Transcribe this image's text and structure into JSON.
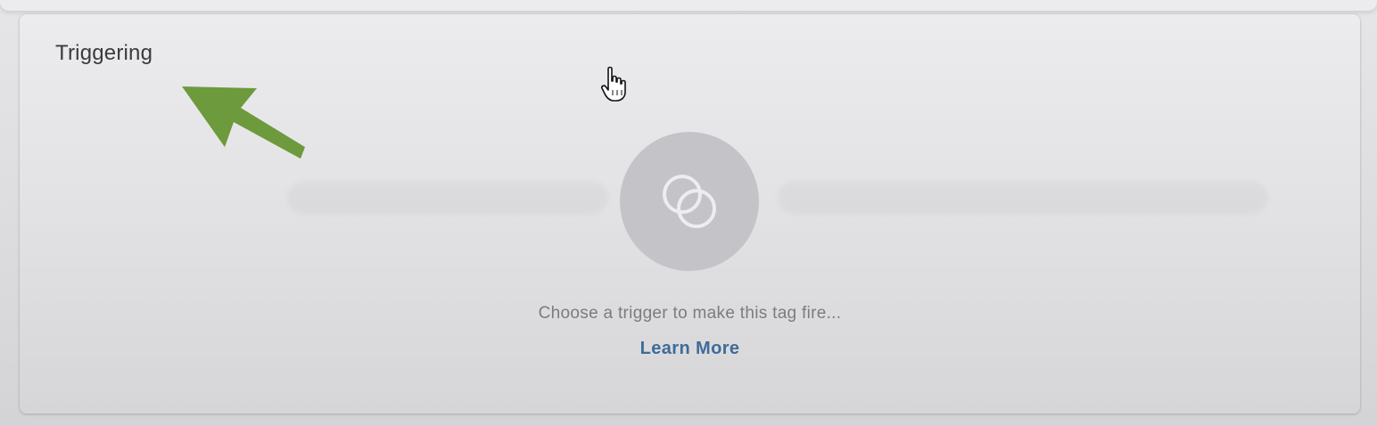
{
  "card": {
    "title": "Triggering",
    "hint": "Choose a trigger to make this tag fire...",
    "learn_more": "Learn More"
  },
  "icons": {
    "trigger_placeholder": "trigger-overlap-circles-icon",
    "annotation": "arrow-annotation-icon",
    "cursor": "hand-pointer-cursor-icon"
  },
  "colors": {
    "link": "#3f6b9a",
    "annotation_arrow": "#6d9a3c",
    "placeholder_circle": "#c4c4c8"
  }
}
